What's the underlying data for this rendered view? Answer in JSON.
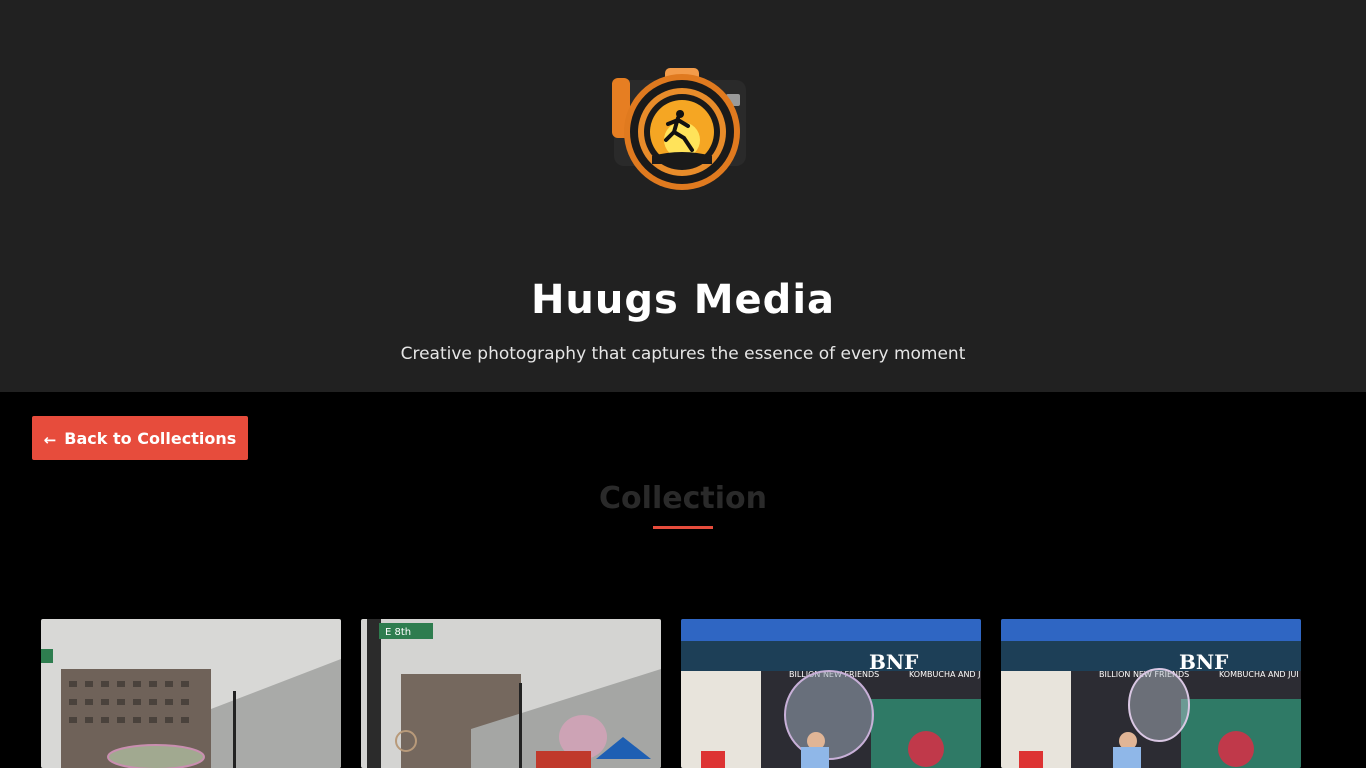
{
  "header": {
    "logo_icon": "camera-runner-logo",
    "site_title": "Huugs Media",
    "tagline": "Creative photography that captures the essence of every moment"
  },
  "nav": {
    "back_arrow": "←",
    "back_label": "Back to Collections"
  },
  "collection": {
    "title": "Collection",
    "accent_color": "#e74c3c"
  },
  "gallery": {
    "photos": [
      {
        "subject": "giant soap bubble near street and buildings"
      },
      {
        "subject": "soap bubbles at E 8th street corner"
      },
      {
        "subject": "child with bubble at BNF kombucha booth"
      },
      {
        "subject": "child with bubble at BNF kombucha booth"
      }
    ],
    "sign_text": "E 8th",
    "booth_banner": "BILLION NEW FRIENDS",
    "booth_logo": "BNF",
    "booth_side": "KOMBUCHA AND JUI"
  }
}
